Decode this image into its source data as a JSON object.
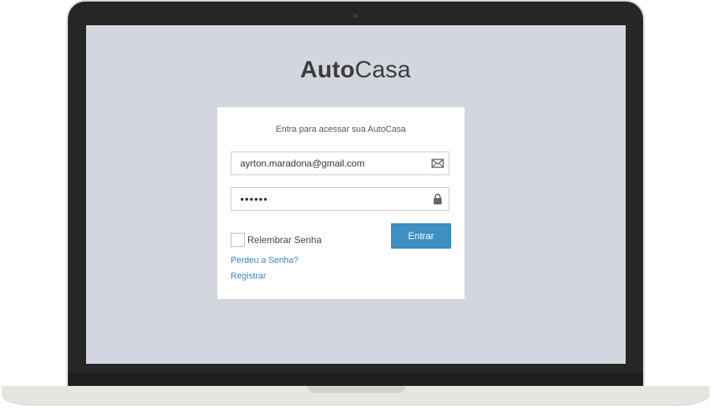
{
  "brand": {
    "name_bold": "Auto",
    "name_light": "Casa"
  },
  "login": {
    "subtitle": "Entra para acessar sua AutoCasa",
    "email": {
      "value": "ayrton.maradona@gmail.com",
      "icon": "envelope-icon"
    },
    "password": {
      "value": "••••••",
      "icon": "lock-icon"
    },
    "remember_label": "Relembrar Senha",
    "submit_label": "Entrar",
    "forgot_link": "Perdeu a Senha?",
    "register_link": "Registrar"
  },
  "colors": {
    "screen_background": "#d3d6df",
    "accent": "#3e8fc4",
    "link": "#3a85b8",
    "laptop_bezel": "#262626"
  }
}
